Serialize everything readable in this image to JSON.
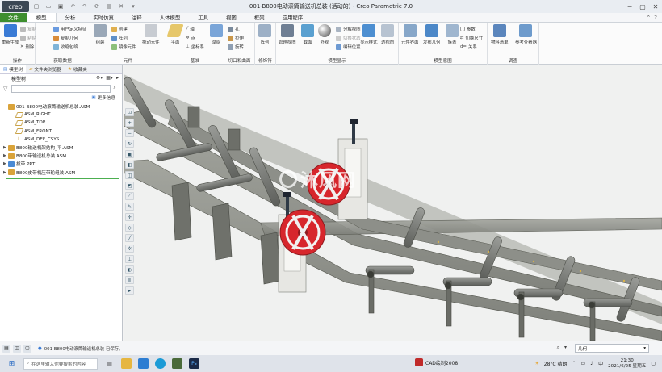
{
  "titlebar": {
    "logo": "creo",
    "title": "001-B800电动滚筒输送机总装 (活动的) - Creo Parametric 7.0"
  },
  "tabs": [
    "文件",
    "模型",
    "分析",
    "实时仿真",
    "注释",
    "人体模型",
    "工具",
    "视图",
    "框架",
    "应用程序"
  ],
  "ribbon": {
    "groups": [
      {
        "label": "操作",
        "items": [
          "重新生成",
          "复制",
          "粘贴",
          "删除"
        ]
      },
      {
        "label": "获取数据",
        "items": [
          "用户定义特征",
          "复制几何",
          "收缩包络"
        ]
      },
      {
        "label": "元件",
        "items": [
          "组装",
          "创建",
          "阵列",
          "镜像元件",
          "拖动元件"
        ]
      },
      {
        "label": "基准",
        "items": [
          "平面",
          "轴",
          "点",
          "坐标系",
          "草绘"
        ]
      },
      {
        "label": "切口和曲面",
        "items": [
          "孔",
          "拉伸",
          "旋转"
        ]
      },
      {
        "label": "修饰符",
        "items": [
          "阵列"
        ]
      },
      {
        "label": "模型显示",
        "items": [
          "管理视图",
          "截面",
          "外观",
          "分解视图",
          "切换状态",
          "编辑位置",
          "显示样式",
          "透视图"
        ]
      },
      {
        "label": "模型意图",
        "items": [
          "元件界面",
          "发布几何",
          "族表",
          "参数",
          "切换尺寸",
          "关系"
        ]
      },
      {
        "label": "调查",
        "items": [
          "物料清单",
          "参考查看器"
        ]
      }
    ]
  },
  "panel": {
    "tabs": [
      "模型树",
      "文件夹浏览器",
      "收藏夹"
    ],
    "title": "模型树",
    "search_placeholder": "",
    "show_label": "更多信息",
    "tree": [
      {
        "label": "001-B800电动滚筒输送机总装.ASM",
        "level": 0,
        "expander": ""
      },
      {
        "label": "ASM_RIGHT",
        "level": 1,
        "expander": ""
      },
      {
        "label": "ASM_TOP",
        "level": 1,
        "expander": ""
      },
      {
        "label": "ASM_FRONT",
        "level": 1,
        "expander": ""
      },
      {
        "label": "ASM_DEF_CSYS",
        "level": 1,
        "expander": ""
      },
      {
        "label": "B800输送机架结构_平.ASM",
        "level": 1,
        "expander": "▶"
      },
      {
        "label": "B800带输送机总装.ASM",
        "level": 1,
        "expander": "▶"
      },
      {
        "label": "拔带.PRT",
        "level": 1,
        "expander": "▶"
      },
      {
        "label": "B800皮带机压带轮组装.ASM",
        "level": 1,
        "expander": "▶"
      }
    ]
  },
  "watermark": "沐风网",
  "status": {
    "message": "001-B800电动滚筒输送机总装 已保存。",
    "filter_value": "几何"
  },
  "taskbar": {
    "search_placeholder": "在这里输入你要搜索的内容",
    "cad_label": "CAD绘制2008",
    "weather": "28°C 晴朗",
    "time": "21:30",
    "date": "2021/6/25 星期五"
  },
  "colors": {
    "file_tab": "#3e8e2e",
    "accent": "#2b6cc4",
    "frame": "#8a8c86",
    "roller": "#787a77",
    "wheel": "#d7262c",
    "motor": "#2a5aa6"
  }
}
